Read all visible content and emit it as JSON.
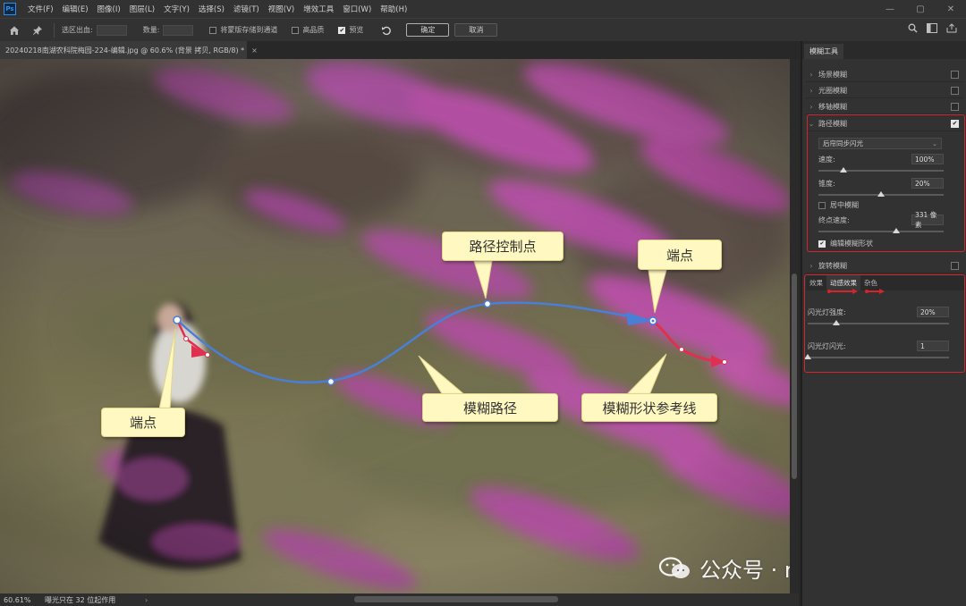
{
  "app": {
    "logo": "Ps"
  },
  "menu": [
    "文件(F)",
    "编辑(E)",
    "图像(I)",
    "图层(L)",
    "文字(Y)",
    "选择(S)",
    "滤镜(T)",
    "视图(V)",
    "增效工具",
    "窗口(W)",
    "帮助(H)"
  ],
  "window_controls": [
    "—",
    "▢",
    "✕"
  ],
  "options_bar": {
    "selection_out_label": "选区出血:",
    "amount_label": "数量:",
    "save_mask_label": "将蒙版存储到通道",
    "high_quality_label": "高品质",
    "preview_label": "预览",
    "preview_checked": true,
    "ok_label": "确定",
    "cancel_label": "取消"
  },
  "document": {
    "tab_title": "20240218南湖农科院梅园-224-编辑.jpg @ 60.6% (背景 拷贝, RGB/8) *",
    "close": "×"
  },
  "status_bar": {
    "zoom": "60.61%",
    "info": "曝光只在 32 位起作用",
    "arrow": "›"
  },
  "callouts": {
    "endpoint_left": "端点",
    "path_control_point": "路径控制点",
    "endpoint_right": "端点",
    "blur_path": "模糊路径",
    "blur_shape_guide": "模糊形状参考线"
  },
  "watermark": {
    "text": "公众号 · mediaTEA"
  },
  "panel": {
    "tab": "模糊工具",
    "sections": [
      {
        "label": "场景模糊",
        "checked": false
      },
      {
        "label": "光圈模糊",
        "checked": false
      },
      {
        "label": "移轴模糊",
        "checked": false
      },
      {
        "label": "路径模糊",
        "checked": true
      }
    ],
    "path_blur": {
      "mode": "后帘同步闪光",
      "speed_label": "速度:",
      "speed_value": "100%",
      "speed_level": 0.2,
      "taper_label": "锥度:",
      "taper_value": "20%",
      "taper_level": 0.5,
      "centered_label": "居中模糊",
      "centered_checked": false,
      "endpoint_speed_label": "终点速度:",
      "endpoint_speed_value": "331 像素",
      "endpoint_speed_level": 0.62,
      "edit_shape_label": "编辑模糊形状",
      "edit_shape_checked": true
    },
    "spin_blur": {
      "label": "旋转模糊",
      "checked": false
    },
    "sub_tabs": [
      "效果",
      "动感效果",
      "杂色"
    ],
    "motion_effects": {
      "strobe_strength_label": "闪光灯强度:",
      "strobe_strength_value": "20%",
      "strobe_strength_level": 0.2,
      "strobe_flashes_label": "闪光灯闪光:",
      "strobe_flashes_value": "1",
      "strobe_flashes_level": 0.0
    }
  },
  "colors": {
    "accent_path": "#4a7fd8",
    "guide_red": "#e03050",
    "annotation_red": "#d8232a",
    "callout_bg": "#fff8c0"
  }
}
